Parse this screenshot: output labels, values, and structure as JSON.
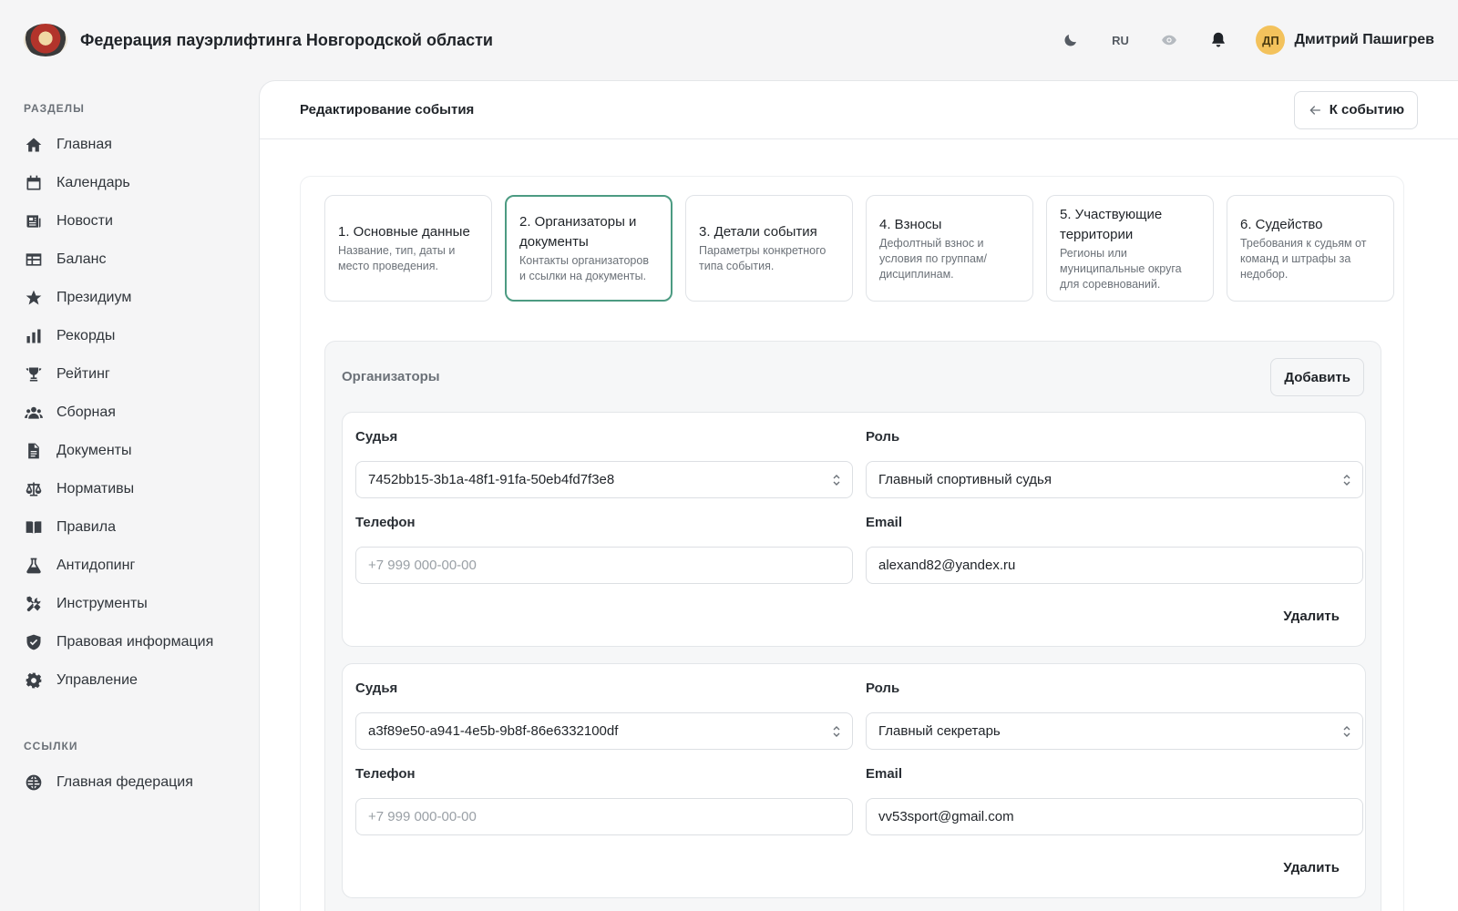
{
  "header": {
    "title": "Федерация пауэрлифтинга Новгородской области",
    "lang": "RU",
    "user": {
      "initials": "ДП",
      "name": "Дмитрий Пашигрев"
    },
    "avatar_color": "#f3c25c"
  },
  "sidebar": {
    "sections_heading": "РАЗДЕЛЫ",
    "items": [
      {
        "label": "Главная",
        "icon": "home-icon"
      },
      {
        "label": "Календарь",
        "icon": "calendar-icon"
      },
      {
        "label": "Новости",
        "icon": "newspaper-icon"
      },
      {
        "label": "Баланс",
        "icon": "table-icon"
      },
      {
        "label": "Президиум",
        "icon": "star-icon"
      },
      {
        "label": "Рекорды",
        "icon": "bar-chart-icon"
      },
      {
        "label": "Рейтинг",
        "icon": "trophy-icon"
      },
      {
        "label": "Сборная",
        "icon": "users-icon"
      },
      {
        "label": "Документы",
        "icon": "document-icon"
      },
      {
        "label": "Нормативы",
        "icon": "scales-icon"
      },
      {
        "label": "Правила",
        "icon": "book-icon"
      },
      {
        "label": "Антидопинг",
        "icon": "flask-icon"
      },
      {
        "label": "Инструменты",
        "icon": "tools-icon"
      },
      {
        "label": "Правовая информация",
        "icon": "shield-icon"
      },
      {
        "label": "Управление",
        "icon": "gear-icon"
      }
    ],
    "links_heading": "ССЫЛКИ",
    "links": [
      {
        "label": "Главная федерация",
        "icon": "globe-icon"
      }
    ]
  },
  "main": {
    "title": "Редактирование события",
    "back_label": "К событию",
    "accent_color": "#4c9b82",
    "steps": [
      {
        "title": "1. Основные данные",
        "desc": "Название, тип, даты и место проведения."
      },
      {
        "title": "2. Организаторы и документы",
        "desc": "Контакты организаторов и ссылки на документы.",
        "active": true
      },
      {
        "title": "3. Детали события",
        "desc": "Параметры конкретного типа события."
      },
      {
        "title": "4. Взносы",
        "desc": "Дефолтный взнос и условия по группам/дисциплинам."
      },
      {
        "title": "5. Участвующие территории",
        "desc": "Регионы или муниципальные округа для соревнований."
      },
      {
        "title": "6. Судейство",
        "desc": "Требования к судьям от команд и штрафы за недобор."
      }
    ],
    "organizers": {
      "title": "Организаторы",
      "add_label": "Добавить",
      "cards": [
        {
          "judge_label": "Судья",
          "judge_value": "7452bb15-3b1a-48f1-91fa-50eb4fd7f3e8",
          "role_label": "Роль",
          "role_value": "Главный спортивный судья",
          "phone_label": "Телефон",
          "phone_placeholder": "+7 999 000-00-00",
          "email_label": "Email",
          "email_value": "alexand82@yandex.ru",
          "delete_label": "Удалить"
        },
        {
          "judge_label": "Судья",
          "judge_value": "a3f89e50-a941-4e5b-9b8f-86e6332100df",
          "role_label": "Роль",
          "role_value": "Главный секретарь",
          "phone_label": "Телефон",
          "phone_placeholder": "+7 999 000-00-00",
          "email_label": "Email",
          "email_value": "vv53sport@gmail.com",
          "delete_label": "Удалить"
        }
      ]
    }
  }
}
